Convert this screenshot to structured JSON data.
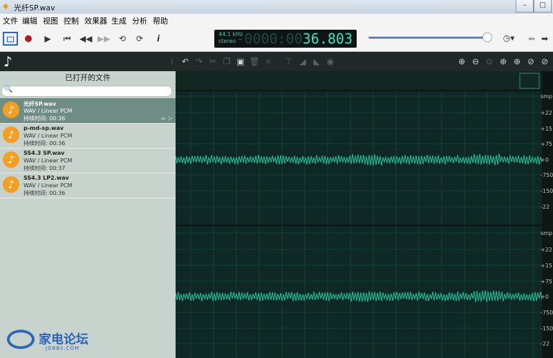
{
  "window": {
    "title": "光纤SP.wav"
  },
  "menu": [
    "文件",
    "编辑",
    "视图",
    "控制",
    "效果器",
    "生成",
    "分析",
    "帮助"
  ],
  "display": {
    "rate": "44.1 kHz",
    "channels": "stereo",
    "time_ghost": "-0000:00",
    "time_value": "36.803"
  },
  "volume": {
    "level": 0.97
  },
  "left_panel": {
    "header": "已打开的文件",
    "files": [
      {
        "name": "光纤SP.wav",
        "type": "WAV / Linear PCM",
        "duration": "持续时间: 00:36",
        "selected": true
      },
      {
        "name": "p-md-sp.wav",
        "type": "WAV / Linear PCM",
        "duration": "持续时间: 00:36",
        "selected": false
      },
      {
        "name": "SS4.3 SP.wav",
        "type": "WAV / Linear PCM",
        "duration": "持续时间: 00:37",
        "selected": false
      },
      {
        "name": "SS4.3 LP2.wav",
        "type": "WAV / Linear PCM",
        "duration": "持续时间: 00:36",
        "selected": false
      }
    ],
    "selected_fx": "⇔ ＞"
  },
  "watermark": {
    "text": "家电论坛",
    "sub": "JDBBS.COM"
  },
  "ruler": {
    "top": [
      "smp",
      "+22",
      "+15",
      "+75",
      "+0",
      "-750",
      "-150",
      "-22"
    ],
    "bottom": [
      "smp",
      "+22",
      "+15",
      "+75",
      "+0",
      "-750",
      "-150",
      "-22"
    ]
  },
  "icons": {
    "app": "wave-app-icon",
    "note": "music-note-icon"
  },
  "colors": {
    "accent": "#2b66b9",
    "wave": "#1fb592",
    "display": "#41e3be",
    "file_icon": "#f2a024",
    "selected_row": "#6f8d85"
  }
}
